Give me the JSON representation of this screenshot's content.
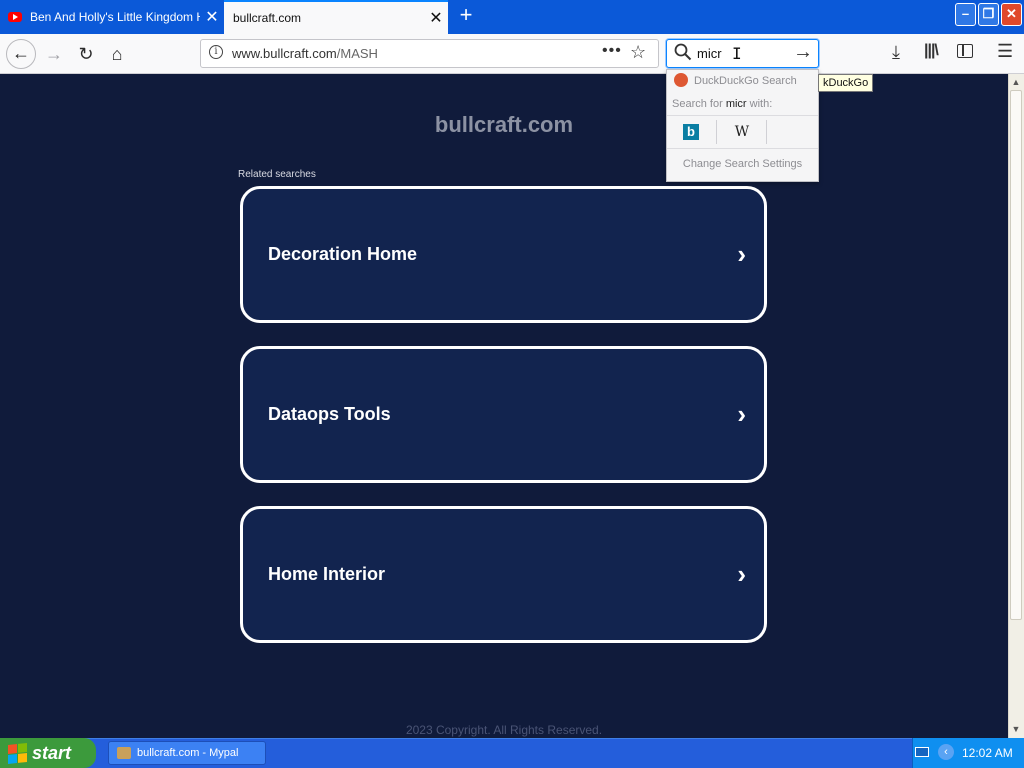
{
  "browser": {
    "tabs": [
      {
        "title": "Ben And Holly's Little Kingdom Holl",
        "close": "✕"
      },
      {
        "title": "bullcraft.com",
        "close": "✕"
      }
    ],
    "new_tab": "+",
    "window_buttons": {
      "minimize": "–",
      "maximize": "❐",
      "close": "✕"
    },
    "nav": {
      "back": "←",
      "forward": "→",
      "reload": "↻",
      "home": "⌂"
    },
    "url": {
      "domain": "www.bullcraft.com",
      "path": "/MASH",
      "info": "i"
    },
    "page_actions": "•••",
    "bookmark_star": "☆",
    "search": {
      "value": "micr",
      "caret": "I",
      "go": "→"
    },
    "toolbar": {
      "downloads": "⤓",
      "library": "|||\\",
      "menu": "☰"
    }
  },
  "search_popup": {
    "engine_name": "DuckDuckGo Search",
    "search_for_prefix": "Search for ",
    "query": "micr",
    "search_for_suffix": " with:",
    "engines": {
      "bing": "b",
      "wikipedia": "W"
    },
    "change_settings": "Change Search Settings",
    "tooltip": "kDuckGo"
  },
  "page": {
    "site_title": "bullcraft.com",
    "related_label": "Related searches",
    "cards": [
      {
        "label": "Decoration Home",
        "chevron": "›"
      },
      {
        "label": "Dataops Tools",
        "chevron": "›"
      },
      {
        "label": "Home Interior",
        "chevron": "›"
      }
    ],
    "footer": "2023 Copyright. All Rights Reserved."
  },
  "scrollbar": {
    "up": "▲",
    "down": "▼"
  },
  "taskbar": {
    "start": "start",
    "task_item": "bullcraft.com - Mypal",
    "tray_arrow": "‹",
    "clock": "12:02 AM"
  },
  "colors": {
    "page_bg": "#101b3b",
    "card_bg": "#12244f",
    "titlebar": "#0b59d8",
    "taskbar": "#245edb",
    "start": "#3c9a3c"
  }
}
